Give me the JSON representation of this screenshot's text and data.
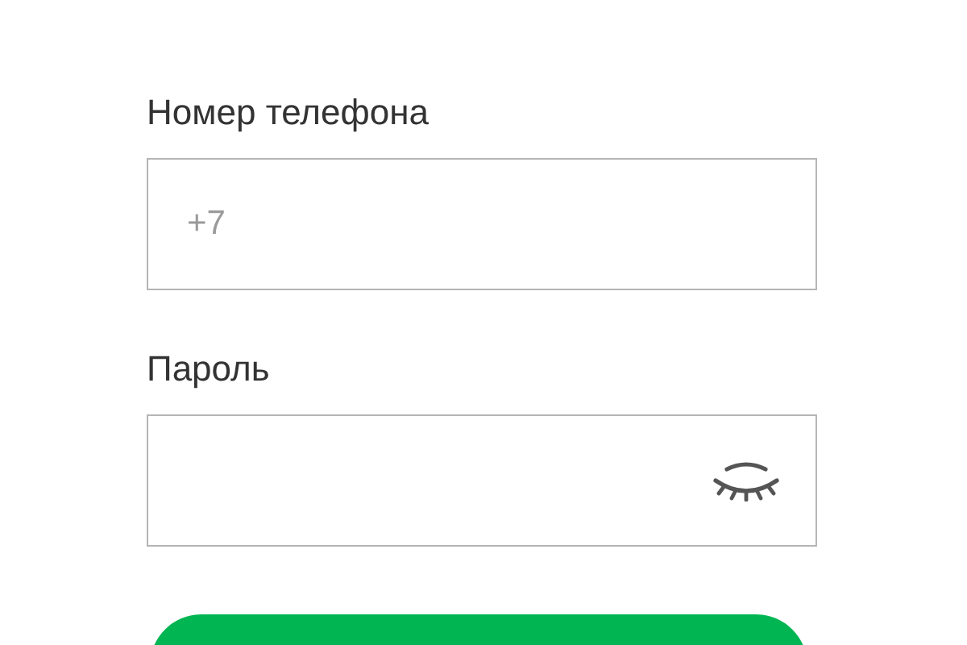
{
  "fields": [
    {
      "kind": "phone",
      "label": "Номер телефона",
      "placeholder": "+7"
    },
    {
      "kind": "password",
      "label": "Пароль"
    }
  ],
  "submit_button": {
    "kind": "primary"
  }
}
